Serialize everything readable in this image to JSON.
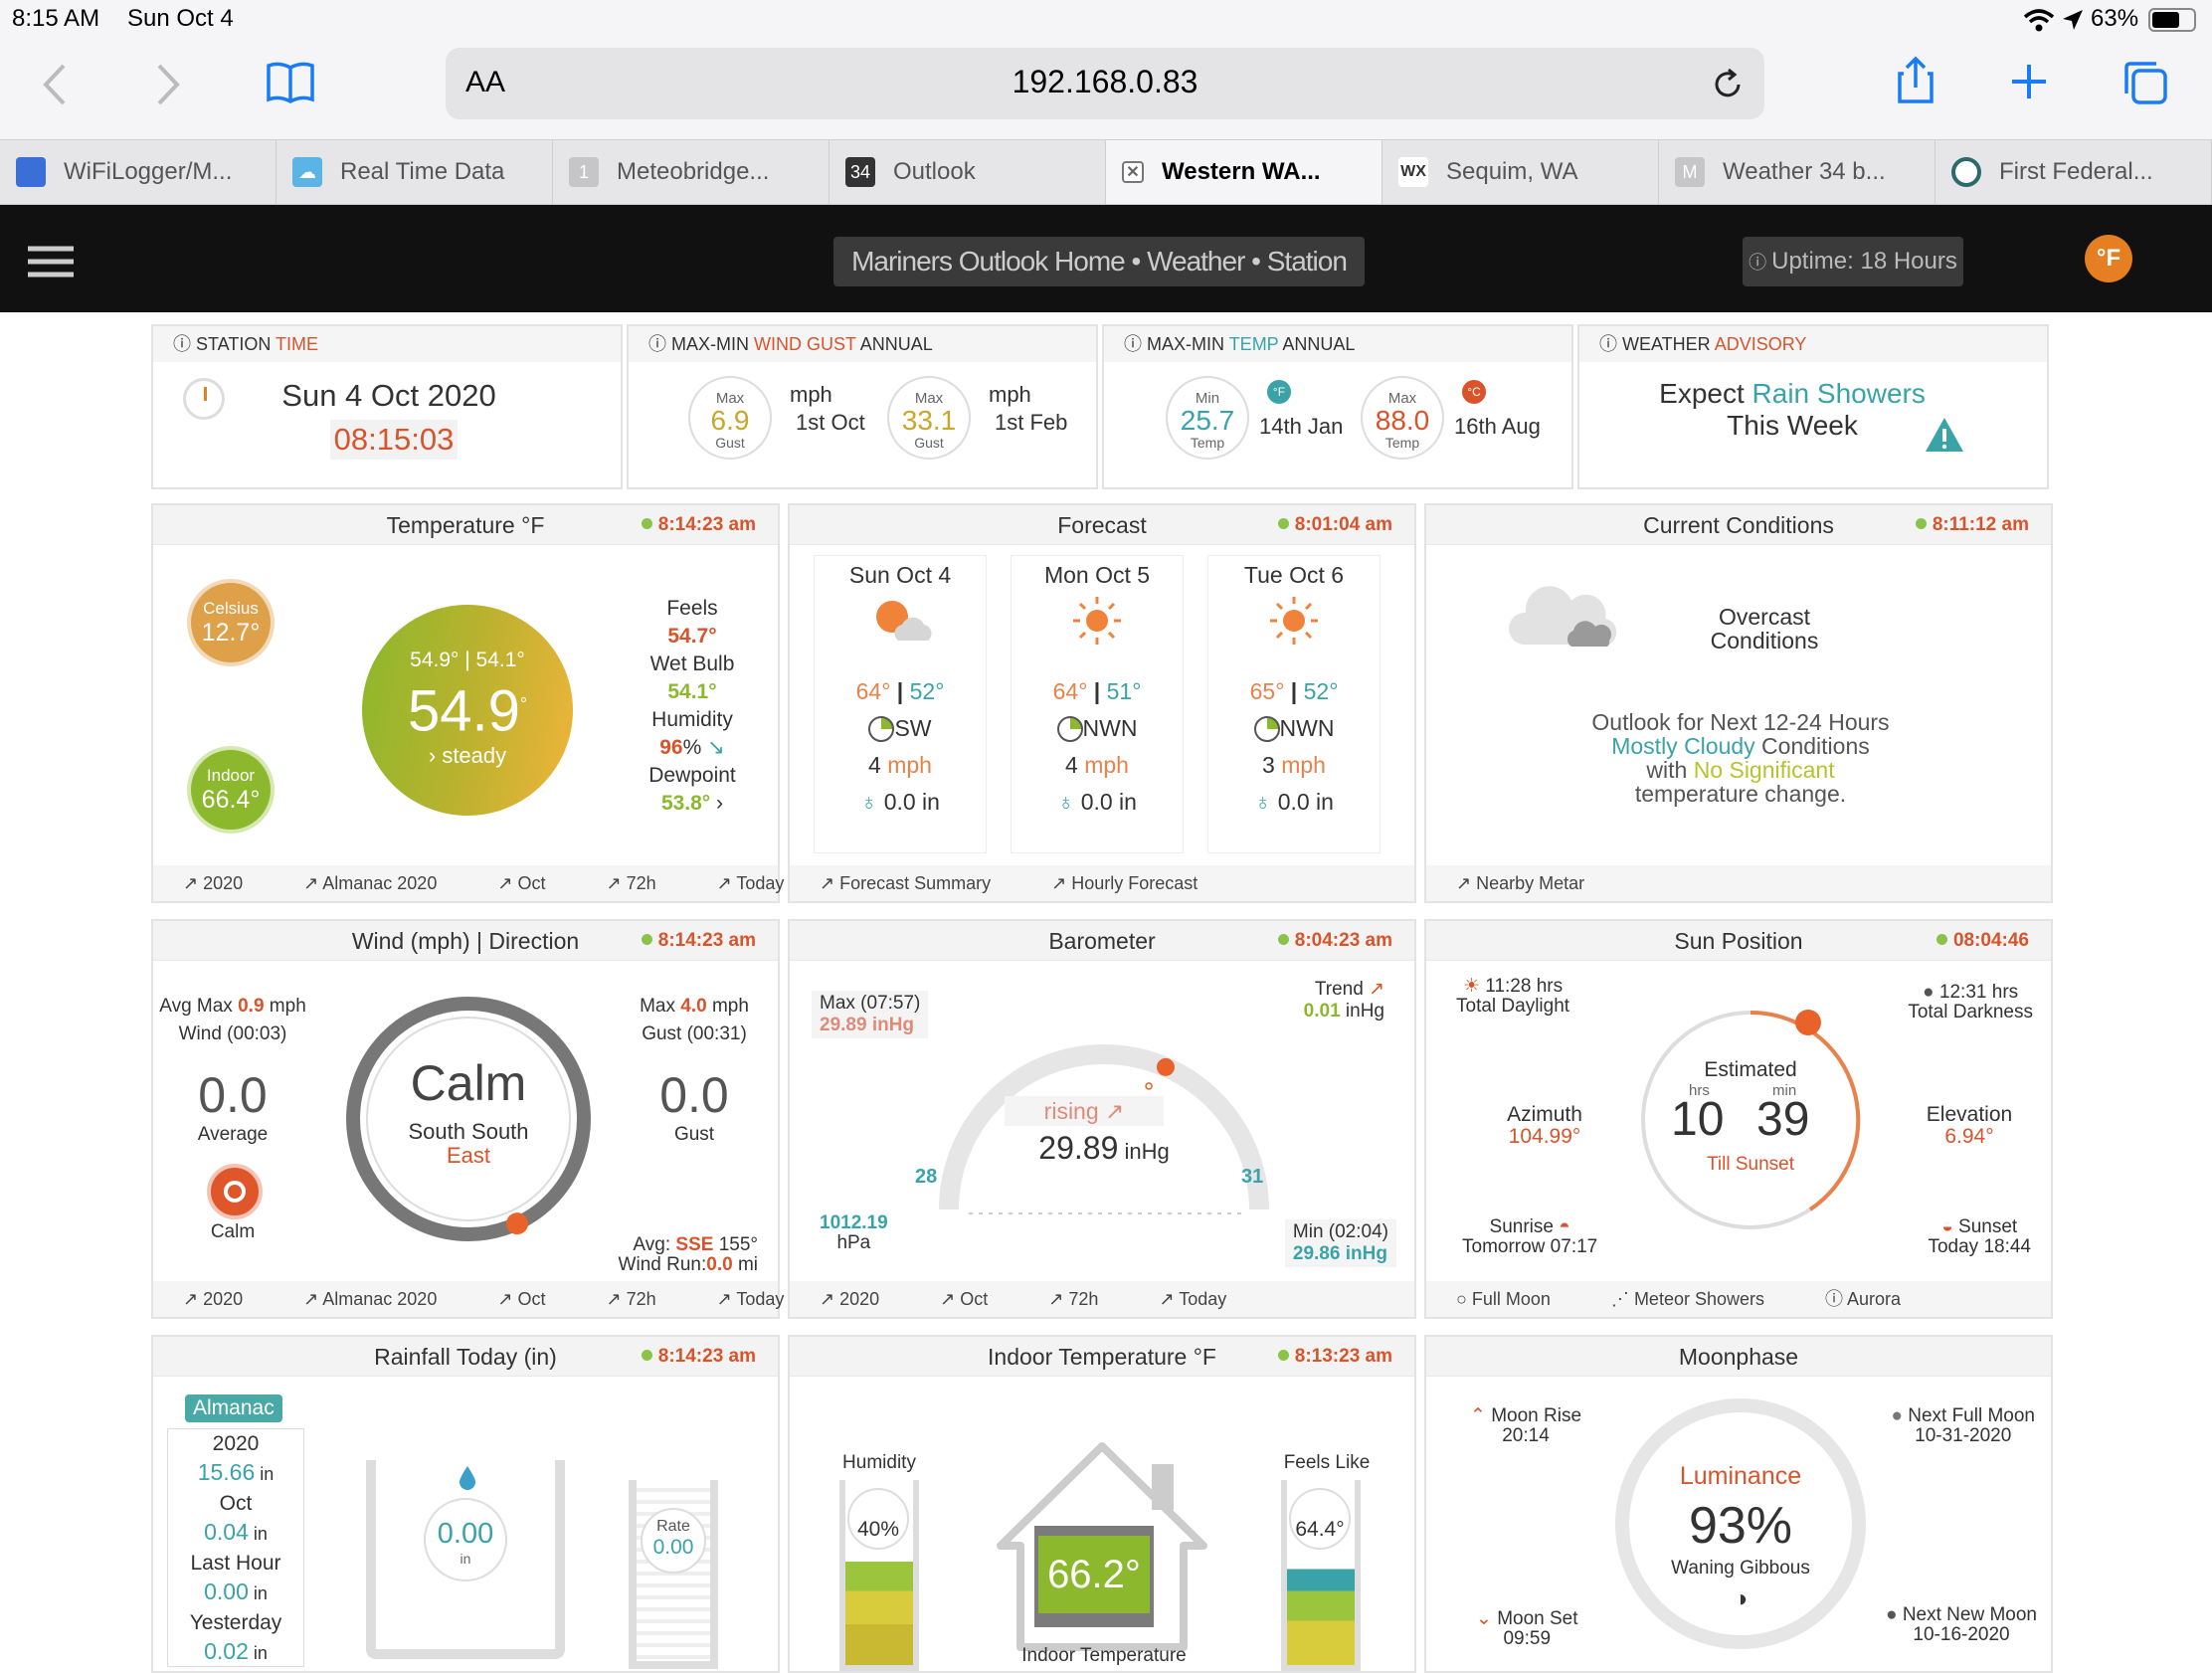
{
  "status": {
    "time": "8:15 AM",
    "date": "Sun Oct 4",
    "battery": "63%"
  },
  "browser": {
    "text_size": "AA",
    "url": "192.168.0.83"
  },
  "tabs": [
    {
      "label": "WiFiLogger/M..."
    },
    {
      "label": "Real Time Data"
    },
    {
      "label": "Meteobridge..."
    },
    {
      "label": "Outlook"
    },
    {
      "label": "Western WA..."
    },
    {
      "label": "Sequim, WA"
    },
    {
      "label": "Weather 34 b..."
    },
    {
      "label": "First Federal..."
    }
  ],
  "nav": {
    "title": "Mariners Outlook  Home • Weather • Station",
    "uptime": "Uptime: 18 Hours",
    "unit": "°F"
  },
  "station_time": {
    "label_a": "STATION ",
    "label_b": "TIME",
    "date": "Sun 4 Oct 2020",
    "time": "08:15:03"
  },
  "gust_annual": {
    "label_a": "MAX-MIN ",
    "label_b": "WIND GUST ",
    "label_c": "ANNUAL",
    "max1_top": "Max",
    "max1_val": "6.9",
    "max1_bot": "Gust",
    "unit1": "mph",
    "date1": "1st Oct",
    "max2_top": "Max",
    "max2_val": "33.1",
    "max2_bot": "Gust",
    "unit2": "mph",
    "date2": "1st Feb"
  },
  "temp_annual": {
    "label_a": "MAX-MIN ",
    "label_b": "TEMP ",
    "label_c": "ANNUAL",
    "min_top": "Min",
    "min_val": "25.7",
    "min_bot": "Temp",
    "min_date": "14th Jan",
    "max_top": "Max",
    "max_val": "88.0",
    "max_bot": "Temp",
    "max_date": "16th Aug"
  },
  "advisory": {
    "label_a": "WEATHER ",
    "label_b": "ADVISORY",
    "l1a": "Expect ",
    "l1b": "Rain Showers",
    "l2": "This Week"
  },
  "temperature": {
    "title": "Temperature °F",
    "time": "8:14:23 am",
    "celsius_label": "Celsius",
    "celsius": "12.7°",
    "indoor_label": "Indoor",
    "indoor": "66.4°",
    "hilo": "54.9° | 54.1°",
    "main": "54.9",
    "deg": "°",
    "trend": "steady",
    "feels_label": "Feels",
    "feels": "54.7°",
    "wetbulb_label": "Wet Bulb",
    "wetbulb": "54.1°",
    "humidity_label": "Humidity",
    "humidity": "96",
    "humidity_unit": "%",
    "dew_label": "Dewpoint",
    "dew": "53.8°",
    "foot": [
      "2020",
      "Almanac 2020",
      "Oct",
      "72h",
      "Today"
    ]
  },
  "forecast": {
    "title": "Forecast",
    "time": "8:01:04 am",
    "days": [
      {
        "name": "Sun Oct 4",
        "hi": "64°",
        "lo": "52°",
        "dir": "SW",
        "wind": "4",
        "unit": "mph",
        "rain": "0.0 in"
      },
      {
        "name": "Mon Oct 5",
        "hi": "64°",
        "lo": "51°",
        "dir": "NWN",
        "wind": "4",
        "unit": "mph",
        "rain": "0.0 in"
      },
      {
        "name": "Tue Oct 6",
        "hi": "65°",
        "lo": "52°",
        "dir": "NWN",
        "wind": "3",
        "unit": "mph",
        "rain": "0.0 in"
      }
    ],
    "foot": [
      "Forecast Summary",
      "Hourly Forecast"
    ]
  },
  "current": {
    "title": "Current Conditions",
    "time": "8:11:12 am",
    "cond1": "Overcast",
    "cond2": "Conditions",
    "out1": "Outlook for Next 12-24 Hours",
    "out2a": "Mostly Cloudy",
    "out2b": " Conditions",
    "out3a": "with ",
    "out3b": "No Significant",
    "out4": "temperature change.",
    "foot": [
      "Nearby Metar"
    ]
  },
  "wind": {
    "title": "Wind (mph) | Direction",
    "time": "8:14:23 am",
    "avgmax_a": "Avg Max ",
    "avgmax_v": "0.9",
    "avgmax_u": " mph",
    "avgmax_l2": "Wind (00:03)",
    "avg_val": "0.0",
    "avg_label": "Average",
    "calm_label": "Calm",
    "center": "Calm",
    "dir1": "South South",
    "dir2": "East",
    "max_a": "Max ",
    "max_v": "4.0",
    "max_u": " mph",
    "max_l2": "Gust (00:31)",
    "gust_val": "0.0",
    "gust_label": "Gust",
    "avgdir_a": "Avg: ",
    "avgdir_b": "SSE",
    "avgdir_c": " 155°",
    "run_a": "Wind Run:",
    "run_b": "0.0",
    "run_c": " mi",
    "dir_deg": 155,
    "foot": [
      "2020",
      "Almanac 2020",
      "Oct",
      "72h",
      "Today"
    ]
  },
  "barometer": {
    "title": "Barometer",
    "time": "8:04:23 am",
    "max_label": "Max (07:57)",
    "max_val": "29.89 inHg",
    "trend_label": "Trend",
    "trend_val": "0.01",
    "trend_unit": " inHg",
    "state": "rising",
    "value": "29.89",
    "unit": " inHg",
    "scale_min": "28",
    "scale_max": "31",
    "hpa": "1012.19",
    "hpa_unit": "hPa",
    "min_label": "Min (02:04)",
    "min_val": "29.86 inHg",
    "reading": 29.89,
    "foot": [
      "2020",
      "Oct",
      "72h",
      "Today"
    ]
  },
  "sun": {
    "title": "Sun Position",
    "time": "08:04:46",
    "daylight": "11:28 hrs",
    "daylight_label": "Total Daylight",
    "darkness": "12:31 hrs",
    "darkness_label": "Total Darkness",
    "azimuth_label": "Azimuth",
    "azimuth": "104.99°",
    "estimated": "Estimated",
    "hrs": "hrs",
    "min": "min",
    "h": "10",
    "m": "39",
    "till": "Till Sunset",
    "elev_label": "Elevation",
    "elev": "6.94°",
    "sunrise_label": "Sunrise",
    "sunrise": "Tomorrow 07:17",
    "sunset_label": "Sunset",
    "sunset": "Today 18:44",
    "foot": [
      "Full Moon",
      "Meteor Showers",
      "Aurora"
    ]
  },
  "rain": {
    "title": "Rainfall Today (in)",
    "time": "8:14:23 am",
    "almanac": "Almanac",
    "y_label": "2020",
    "y_val": "15.66",
    "m_label": "Oct",
    "m_val": "0.04",
    "h_label": "Last Hour",
    "h_val": "0.00",
    "yd_label": "Yesterday",
    "yd_val": "0.02",
    "unit": " in",
    "today": "0.00",
    "today_unit": "in",
    "rate_label": "Rate",
    "rate": "0.00"
  },
  "indoor": {
    "title": "Indoor Temperature °F",
    "time": "8:13:23 am",
    "hum_label": "Humidity",
    "hum": "40%",
    "temp": "66.2°",
    "temp_label": "Indoor Temperature",
    "feels_label": "Feels Like",
    "feels": "64.4°"
  },
  "moon": {
    "title": "Moonphase",
    "rise_label": "Moon Rise",
    "rise": "20:14",
    "full_label": "Next Full Moon",
    "full": "10-31-2020",
    "lum_label": "Luminance",
    "lum": "93%",
    "phase": "Waning Gibbous",
    "set_label": "Moon Set",
    "set": "09:59",
    "new_label": "Next New Moon",
    "new": "10-16-2020"
  },
  "colors": {
    "orange": "#d9532b",
    "teal": "#3aa3a8",
    "green": "#8bb82c",
    "nav": "#111111"
  }
}
